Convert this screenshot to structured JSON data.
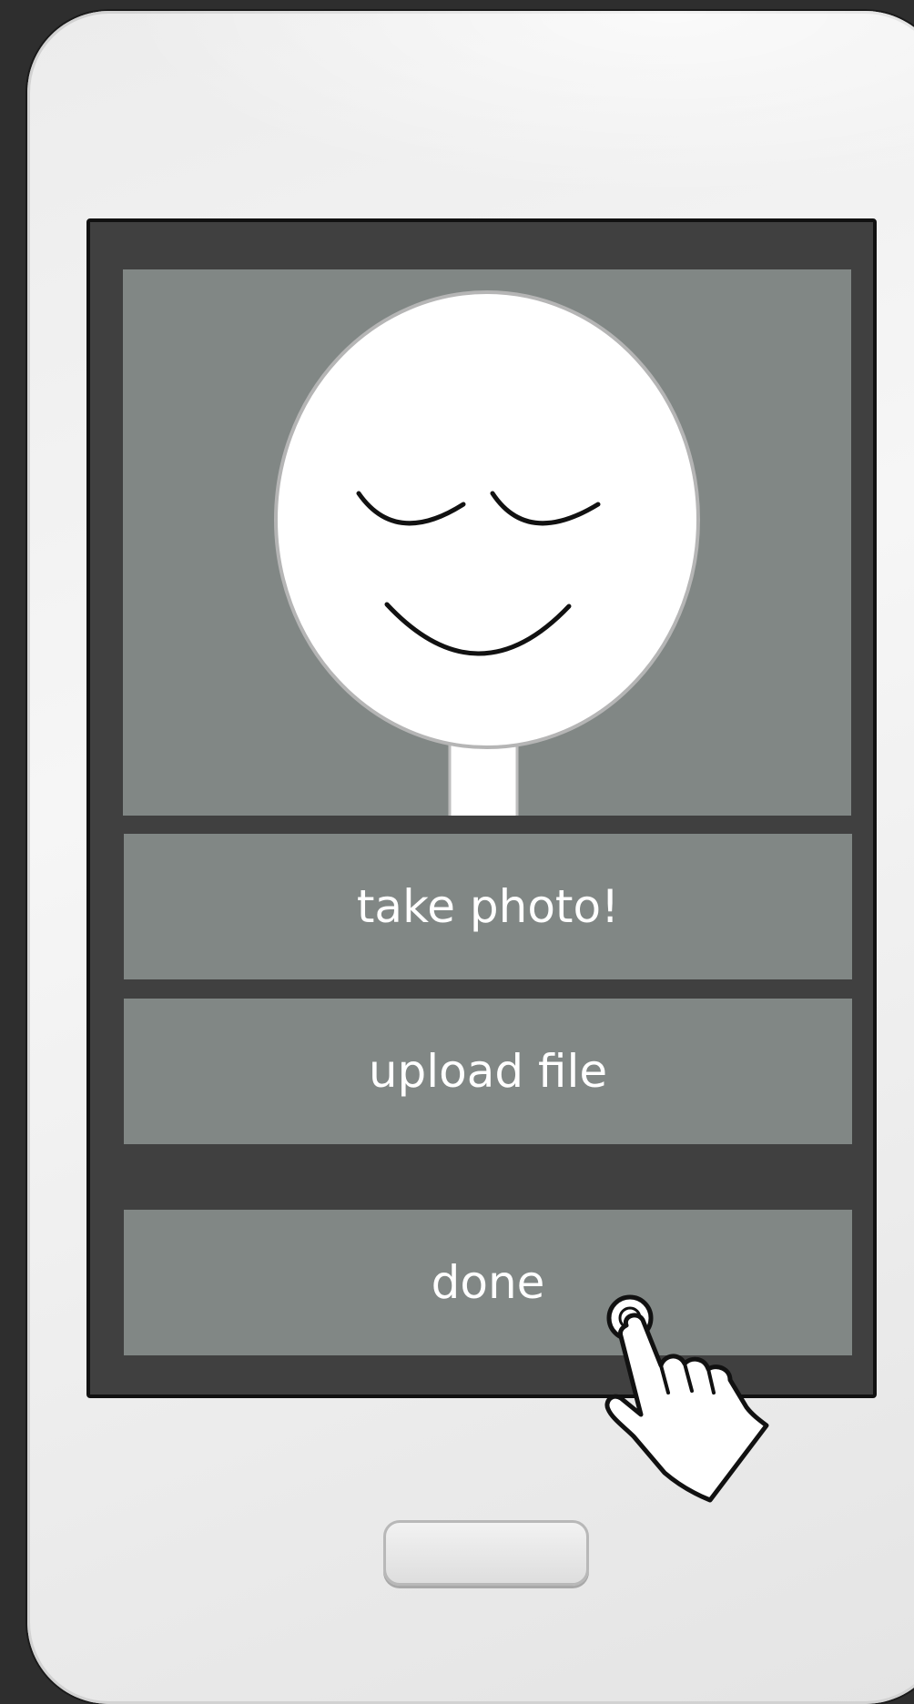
{
  "photo": {
    "avatar_icon": "smiling-face-placeholder"
  },
  "buttons": {
    "take_photo_label": "take photo!",
    "upload_file_label": "upload file",
    "done_label": "done"
  },
  "cursor": {
    "icon": "tap-hand-cursor"
  },
  "colors": {
    "screen_background": "#404040",
    "button_background": "#818785",
    "button_text": "#ffffff",
    "phone_body": "#ececec"
  }
}
